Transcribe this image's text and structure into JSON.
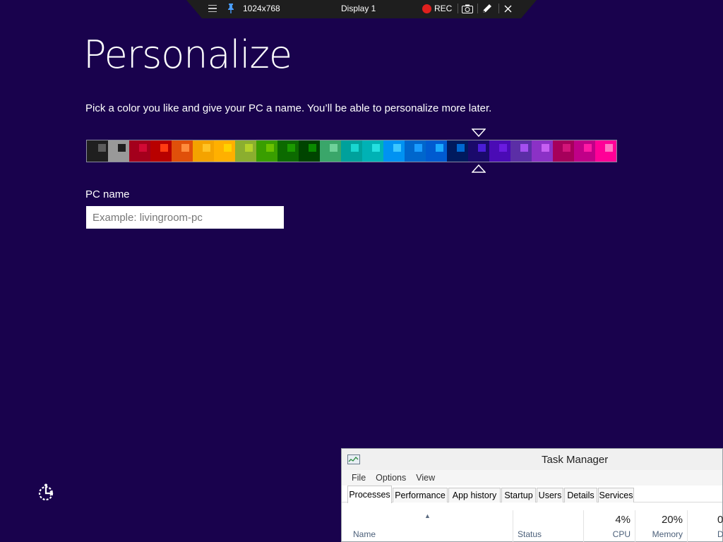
{
  "remote_toolbar": {
    "resolution": "1024x768",
    "display": "Display 1",
    "rec_label": "REC",
    "icons": [
      "menu-icon",
      "pin-icon",
      "record-icon",
      "camera-icon",
      "pencil-icon",
      "close-icon"
    ]
  },
  "setup": {
    "title": "Personalize",
    "instructions": "Pick a color you like and give your PC a name. You’ll be able to personalize more later.",
    "pc_name_label": "PC name",
    "pc_name_value": "",
    "pc_name_placeholder": "Example: livingroom-pc",
    "selected_color_index": 18,
    "colors": [
      {
        "bg": "#1f1f1f",
        "accent": "#5c5c5c"
      },
      {
        "bg": "#999999",
        "accent": "#1f1f1f"
      },
      {
        "bg": "#a4001c",
        "accent": "#d10a35"
      },
      {
        "bg": "#b80000",
        "accent": "#ff3b12"
      },
      {
        "bg": "#e0500a",
        "accent": "#ff8c3c"
      },
      {
        "bg": "#f4a300",
        "accent": "#ffc325"
      },
      {
        "bg": "#ffb000",
        "accent": "#ffd200"
      },
      {
        "bg": "#8bae2f",
        "accent": "#b4d22a"
      },
      {
        "bg": "#399e00",
        "accent": "#6bc200"
      },
      {
        "bg": "#0c6a00",
        "accent": "#1b9b00"
      },
      {
        "bg": "#004400",
        "accent": "#0a8a00"
      },
      {
        "bg": "#3aa66a",
        "accent": "#6fd19a"
      },
      {
        "bg": "#00a19c",
        "accent": "#19d6d0"
      },
      {
        "bg": "#00b2b5",
        "accent": "#25e0e0"
      },
      {
        "bg": "#0092f2",
        "accent": "#3cc6ff"
      },
      {
        "bg": "#0066cc",
        "accent": "#1a9cff"
      },
      {
        "bg": "#005ad0",
        "accent": "#1ba9ff"
      },
      {
        "bg": "#001a5e",
        "accent": "#0068d0"
      },
      {
        "bg": "#1a0a6b",
        "accent": "#4a1dd6"
      },
      {
        "bg": "#4a0bb5",
        "accent": "#6a1be0"
      },
      {
        "bg": "#5b2ea6",
        "accent": "#a44ff0"
      },
      {
        "bg": "#8b31c6",
        "accent": "#c65ff2"
      },
      {
        "bg": "#a6005b",
        "accent": "#d31579"
      },
      {
        "bg": "#c00088",
        "accent": "#ff1aa5"
      },
      {
        "bg": "#ff0097",
        "accent": "#ff75c3"
      }
    ]
  },
  "task_manager": {
    "title": "Task Manager",
    "menu": [
      "File",
      "Options",
      "View"
    ],
    "tabs": [
      {
        "label": "Processes",
        "active": true
      },
      {
        "label": "Performance",
        "active": false
      },
      {
        "label": "App history",
        "active": false
      },
      {
        "label": "Startup",
        "active": false
      },
      {
        "label": "Users",
        "active": false
      },
      {
        "label": "Details",
        "active": false
      },
      {
        "label": "Services",
        "active": false
      }
    ],
    "columns": [
      {
        "label": "Name",
        "value": ""
      },
      {
        "label": "Status",
        "value": ""
      },
      {
        "label": "CPU",
        "value": "4%"
      },
      {
        "label": "Memory",
        "value": "20%"
      },
      {
        "label": "D",
        "value": "0"
      }
    ]
  }
}
